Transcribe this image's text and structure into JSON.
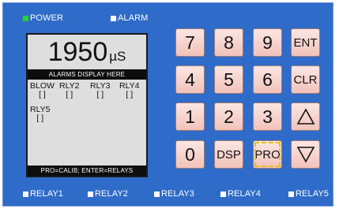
{
  "indicators": {
    "power": "POWER",
    "alarm": "ALARM"
  },
  "display": {
    "value": "1950",
    "unit": "µS",
    "alarm_line": "ALARMS DISPLAY HERE",
    "relays": [
      {
        "label": "BLOW",
        "state": "[ ]"
      },
      {
        "label": "RLY2",
        "state": "[ ]"
      },
      {
        "label": "RLY3",
        "state": "[ ]"
      },
      {
        "label": "RLY4",
        "state": "[ ]"
      },
      {
        "label": "RLY5",
        "state": "[ ]"
      }
    ],
    "footer": "PRO=CALIB; ENTER=RELAYS"
  },
  "keypad": {
    "k7": "7",
    "k8": "8",
    "k9": "9",
    "ent": "ENT",
    "k4": "4",
    "k5": "5",
    "k6": "6",
    "clr": "CLR",
    "k1": "1",
    "k2": "2",
    "k3": "3",
    "up": "up-triangle-icon",
    "k0": "0",
    "dsp": "DSP",
    "pro": "PRO",
    "down": "down-triangle-icon"
  },
  "relay_indicators": [
    "RELAY1",
    "RELAY2",
    "RELAY3",
    "RELAY4",
    "RELAY5"
  ],
  "colors": {
    "panel": "#2f6bc9",
    "power_led": "#29d12a",
    "key_face": "#f2c2bb",
    "selected_outline": "#e3c31c"
  }
}
